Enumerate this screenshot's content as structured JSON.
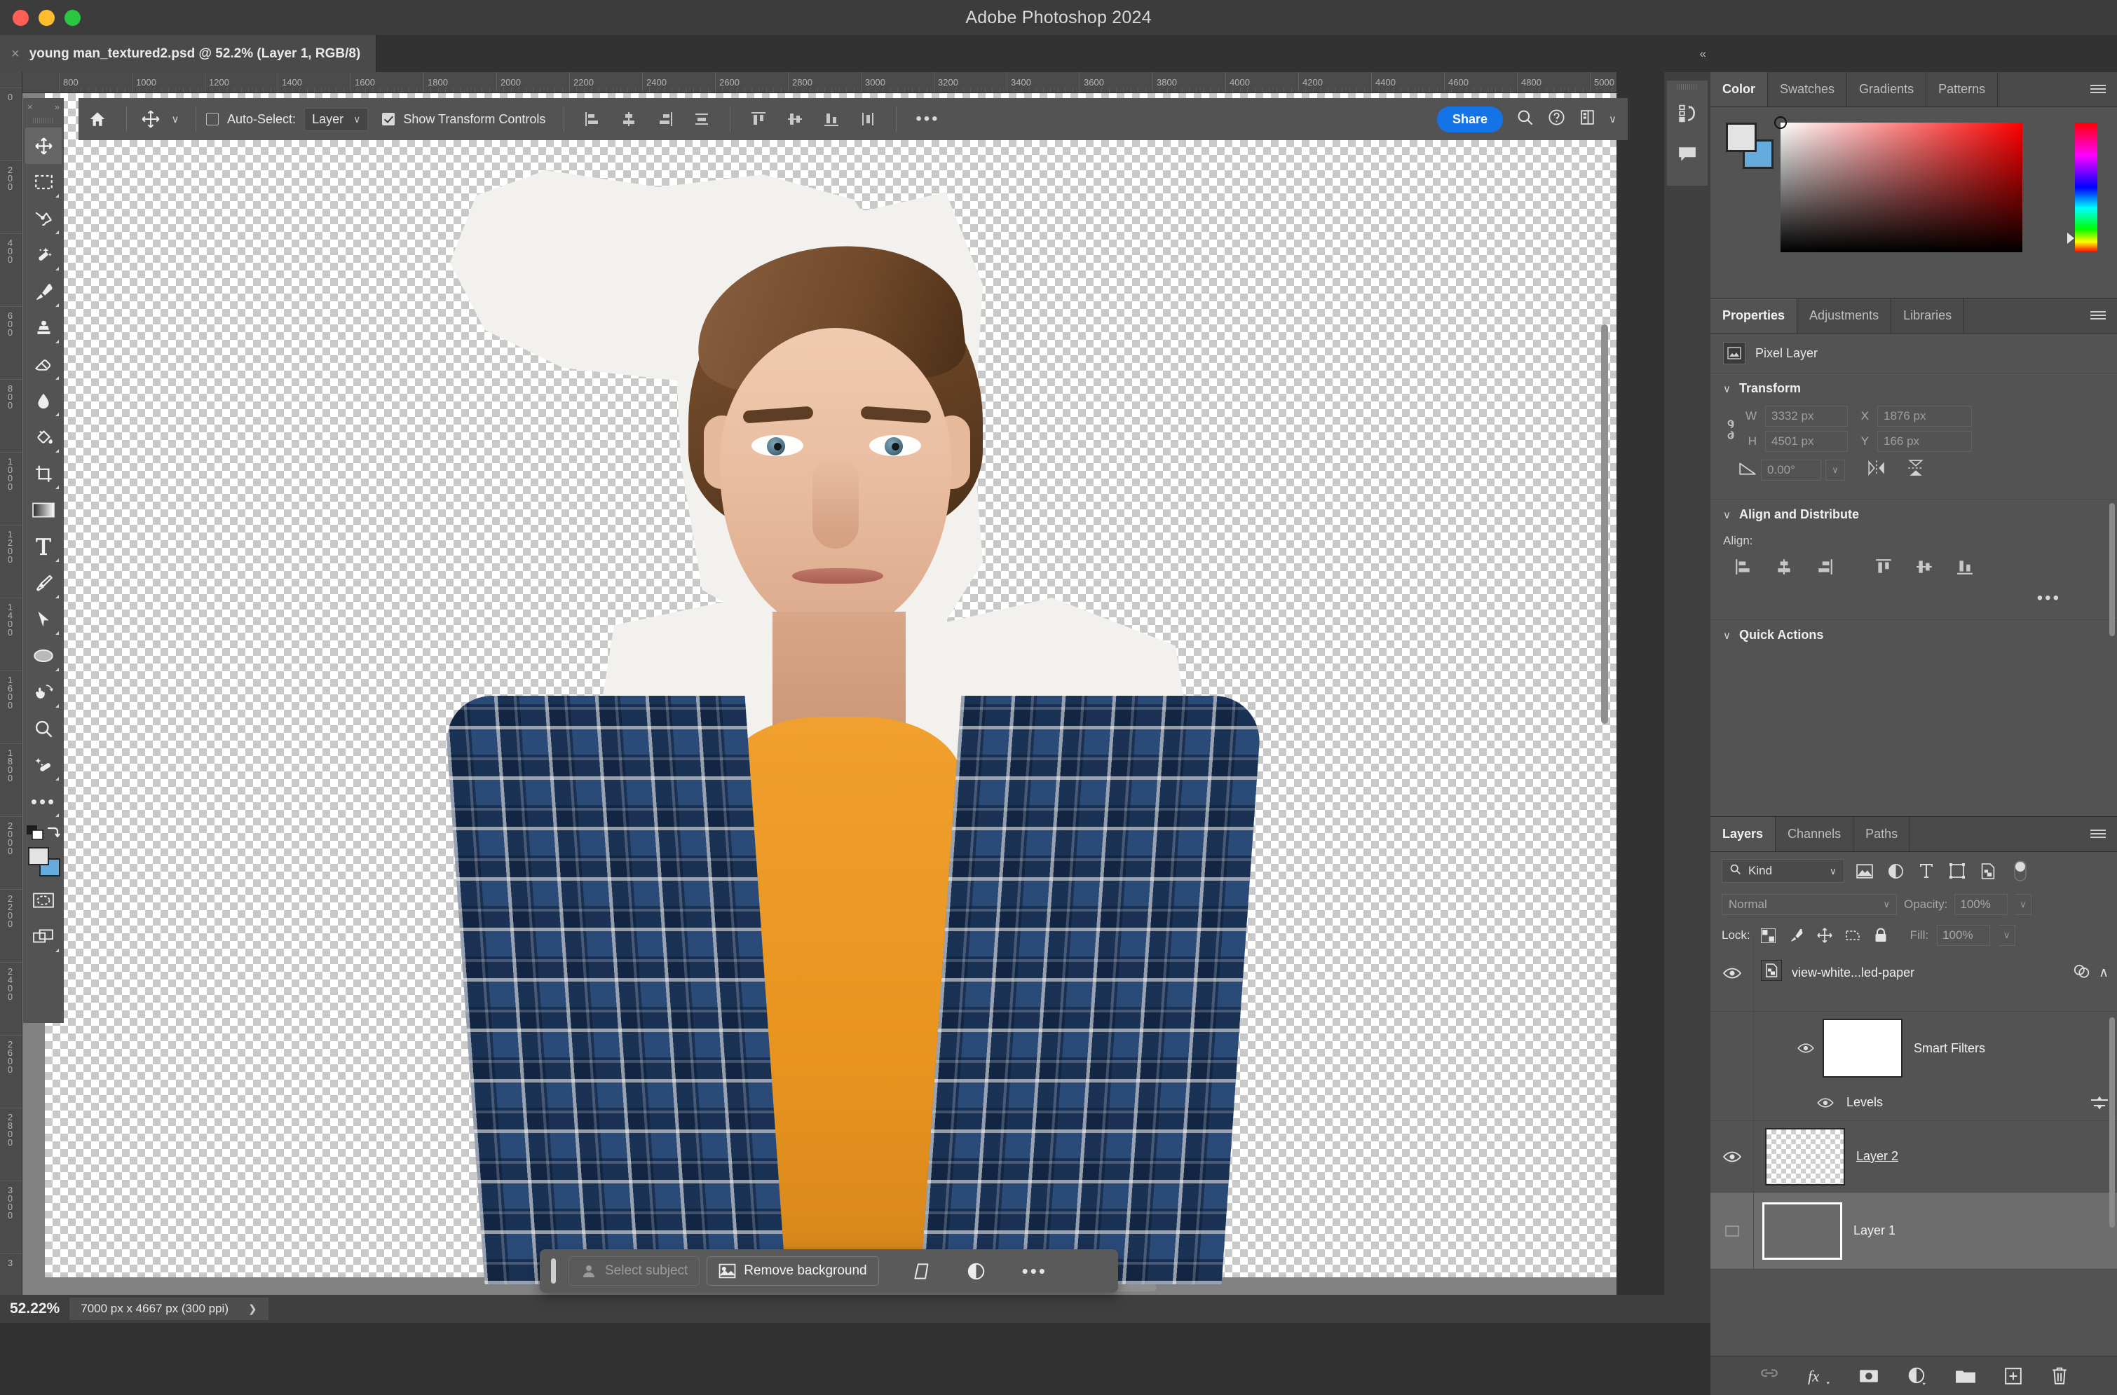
{
  "window": {
    "app_title": "Adobe Photoshop 2024",
    "traffic_lights": [
      "close",
      "minimize",
      "maximize"
    ]
  },
  "document_tab": {
    "close_glyph": "×",
    "title": "young man_textured2.psd @ 52.2% (Layer 1, RGB/8)"
  },
  "options_bar": {
    "home_icon": "home-icon",
    "tool_icon": "move-tool-icon",
    "tool_chevron": "∨",
    "auto_select_label": "Auto-Select:",
    "auto_select_checked": false,
    "auto_select_target": "Layer",
    "auto_select_chevron": "∨",
    "show_transform_label": "Show Transform Controls",
    "show_transform_checked": true,
    "align_buttons": [
      "align-left-edges",
      "align-horizontal-centers",
      "align-right-edges",
      "distribute-horizontally",
      "align-top-edges",
      "align-vertical-centers",
      "align-bottom-edges",
      "distribute-vertically"
    ],
    "more_label": "•••",
    "share_label": "Share",
    "search_icon": "search-icon",
    "help_icon": "help-icon",
    "workspace_icon": "workspace-icon",
    "workspace_chevron": "∨"
  },
  "toolbar": {
    "close_glyph": "×",
    "expand_glyph": "»",
    "tools": [
      {
        "name": "move-tool",
        "active": true,
        "has_flyout": false
      },
      {
        "name": "rectangular-marquee-tool",
        "active": false,
        "has_flyout": true
      },
      {
        "name": "lasso-tool",
        "active": false,
        "has_flyout": true
      },
      {
        "name": "object-selection-tool",
        "active": false,
        "has_flyout": true
      },
      {
        "name": "brush-tool",
        "active": false,
        "has_flyout": true
      },
      {
        "name": "clone-stamp-tool",
        "active": false,
        "has_flyout": true
      },
      {
        "name": "eraser-tool",
        "active": false,
        "has_flyout": true
      },
      {
        "name": "blur-tool",
        "active": false,
        "has_flyout": true
      },
      {
        "name": "paint-bucket-tool",
        "active": false,
        "has_flyout": true
      },
      {
        "name": "crop-tool",
        "active": false,
        "has_flyout": true
      },
      {
        "name": "gradient-tool",
        "active": false,
        "has_flyout": true
      },
      {
        "name": "type-tool",
        "active": false,
        "has_flyout": true
      },
      {
        "name": "pen-tool",
        "active": false,
        "has_flyout": true
      },
      {
        "name": "path-selection-tool",
        "active": false,
        "has_flyout": true
      },
      {
        "name": "ellipse-tool",
        "active": false,
        "has_flyout": true
      },
      {
        "name": "rotate-view-tool",
        "active": false,
        "has_flyout": true
      },
      {
        "name": "zoom-tool",
        "active": false,
        "has_flyout": false
      },
      {
        "name": "spot-healing-brush-tool",
        "active": false,
        "has_flyout": true
      },
      {
        "name": "edit-toolbar",
        "active": false,
        "has_flyout": true
      }
    ],
    "default_colors_icon": "default-colors-icon",
    "swap_colors_icon": "swap-colors-icon",
    "foreground_color": "#e3e3e3",
    "background_color": "#66abdd",
    "quick_mask_icon": "quick-mask-icon",
    "screen_mode_icon": "screen-mode-icon"
  },
  "rulers": {
    "unit": "px",
    "horizontal_labels": [
      "800",
      "1000",
      "1200",
      "1400",
      "1600",
      "1800",
      "2000",
      "2200",
      "2400",
      "2600",
      "2800",
      "3000",
      "3200",
      "3400",
      "3600",
      "3800",
      "4000",
      "4200",
      "4400",
      "4600",
      "4800",
      "5000"
    ],
    "vertical_labels": [
      "0",
      "200",
      "400",
      "600",
      "800",
      "1000",
      "1200",
      "1400",
      "1600",
      "1800",
      "2000",
      "2200",
      "2400",
      "2600",
      "2800",
      "3000",
      "3"
    ]
  },
  "contextual_task_bar": {
    "grip": "drag-handle",
    "select_subject_label": "Select subject",
    "select_subject_enabled": false,
    "remove_background_label": "Remove background",
    "transform_icon": "transform-icon",
    "adjustment_icon": "adjustment-layer-icon",
    "more_label": "•••"
  },
  "status_bar": {
    "zoom": "52.22%",
    "doc_info": "7000 px x 4667 px (300 ppi)",
    "chevron": "❯"
  },
  "dock_strip": {
    "collapse_glyph": "«",
    "buttons": [
      {
        "name": "history-icon"
      },
      {
        "name": "comments-icon"
      }
    ]
  },
  "color_panel": {
    "tabs": [
      "Color",
      "Swatches",
      "Gradients",
      "Patterns"
    ],
    "active_tab": "Color",
    "menu_icon": "panel-menu-icon",
    "foreground_color": "#e3e3e3",
    "background_color": "#66abdd",
    "field_icon": "color-field",
    "hue_slider_icon": "hue-slider"
  },
  "properties_panel": {
    "tabs": [
      "Properties",
      "Adjustments",
      "Libraries"
    ],
    "active_tab": "Properties",
    "menu_icon": "panel-menu-icon",
    "layer_type_icon": "pixel-layer-icon",
    "layer_type_label": "Pixel Layer",
    "transform": {
      "section_title": "Transform",
      "chevron": "∨",
      "link_icon": "link-dimensions-icon",
      "w_label": "W",
      "w_value": "3332 px",
      "x_label": "X",
      "x_value": "1876 px",
      "h_label": "H",
      "h_value": "4501 px",
      "y_label": "Y",
      "y_value": "166 px",
      "angle_icon": "angle-icon",
      "angle_value": "0.00°",
      "angle_chevron": "∨",
      "flip_horizontal_icon": "flip-horizontal-icon",
      "flip_vertical_icon": "flip-vertical-icon"
    },
    "align_distribute": {
      "section_title": "Align and Distribute",
      "chevron": "∨",
      "align_label": "Align:",
      "buttons": [
        "align-left-edges",
        "align-horizontal-centers",
        "align-right-edges",
        "align-top-edges",
        "align-vertical-centers",
        "align-bottom-edges"
      ],
      "more_label": "•••"
    },
    "quick_actions": {
      "section_title": "Quick Actions",
      "chevron": "∨"
    }
  },
  "layers_panel": {
    "tabs": [
      "Layers",
      "Channels",
      "Paths"
    ],
    "active_tab": "Layers",
    "menu_icon": "panel-menu-icon",
    "filter": {
      "search_icon": "search-icon",
      "kind_label": "Kind",
      "chevron": "∨",
      "type_filters": [
        "pixel-filter-icon",
        "adjustment-filter-icon",
        "type-filter-icon",
        "shape-filter-icon",
        "smart-object-filter-icon"
      ],
      "toggle_name": "filter-toggle-switch"
    },
    "blend_mode": "Normal",
    "blend_chevron": "∨",
    "opacity_label": "Opacity:",
    "opacity_value": "100%",
    "lock_label": "Lock:",
    "lock_icons": [
      "lock-transparent-pixels-icon",
      "lock-image-pixels-icon",
      "lock-position-icon",
      "lock-artboard-icon",
      "lock-all-icon"
    ],
    "fill_label": "Fill:",
    "fill_value": "100%",
    "layers": [
      {
        "name": "view-white...led-paper",
        "visible": true,
        "selected": false,
        "thumb": "paper-texture",
        "clipping_mask": true,
        "is_smart_object": true,
        "badges": [
          "layer-effects-icon"
        ],
        "collapse_chevron": "∧",
        "smart_filters": {
          "label": "Smart Filters",
          "visible": true,
          "mask_thumb": "white-mask",
          "filters": [
            {
              "label": "Levels",
              "visible": true,
              "settings_icon": "filter-settings-icon"
            }
          ]
        }
      },
      {
        "name": "Layer 2",
        "visible": true,
        "selected": false,
        "thumb": "transparent",
        "underlined": true
      },
      {
        "name": "Layer 1",
        "visible": false,
        "selected": true,
        "thumb": "gray"
      }
    ],
    "footer_icons": [
      "link-layers-icon",
      "layer-style-fx-icon",
      "add-layer-mask-icon",
      "new-adjustment-layer-icon",
      "new-group-icon",
      "new-layer-icon",
      "delete-layer-icon"
    ]
  }
}
